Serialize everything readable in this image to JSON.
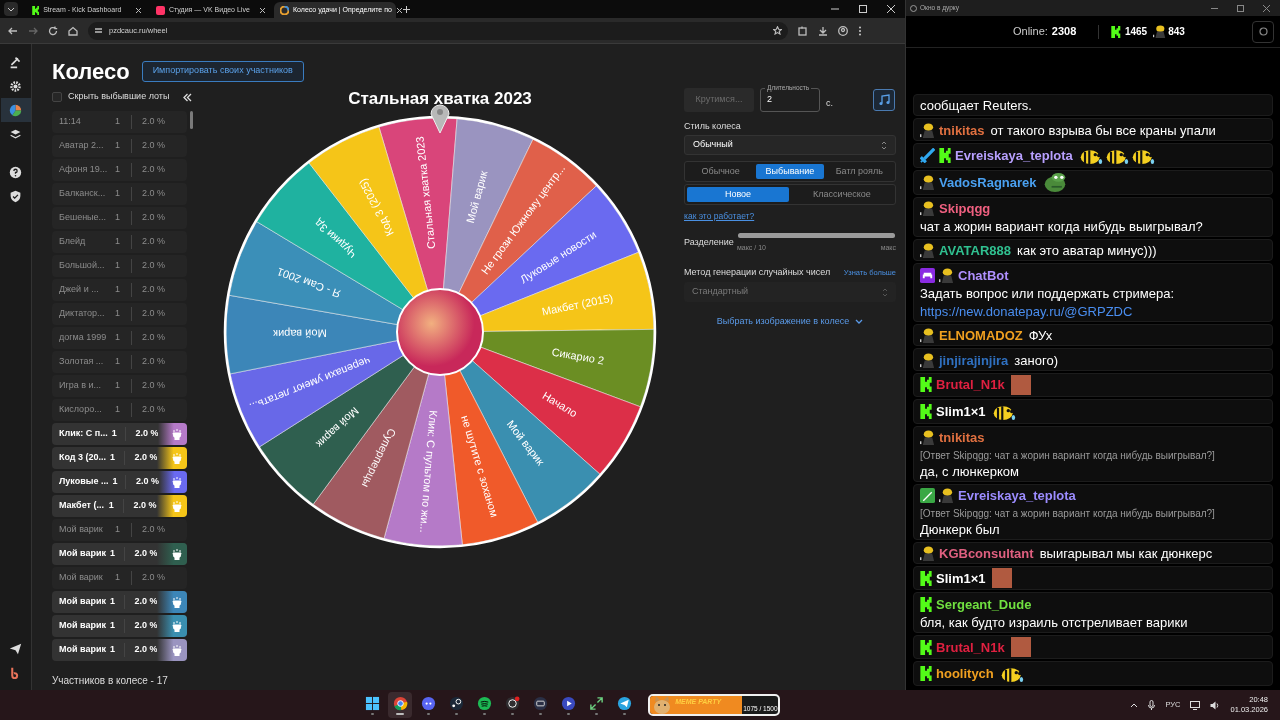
{
  "browser": {
    "tabs": [
      {
        "label": "Stream - Kick Dashboard",
        "kind": "kick",
        "selected": false
      },
      {
        "label": "Студия — VK Видео Live",
        "kind": "vk",
        "selected": false
      },
      {
        "label": "Колесо удачи | Определите по",
        "kind": "wheel",
        "selected": true
      }
    ],
    "url": "pzdcauc.ru/wheel"
  },
  "sidebar": {
    "items": [
      {
        "kind": "gavel",
        "selected": false
      },
      {
        "kind": "gear",
        "selected": false
      },
      {
        "kind": "pie",
        "selected": true
      },
      {
        "kind": "layers",
        "selected": false
      },
      {
        "kind": "help",
        "selected": false
      },
      {
        "kind": "shield",
        "selected": false
      },
      {
        "kind": "plane",
        "selected": false
      },
      {
        "kind": "logo",
        "selected": false
      }
    ]
  },
  "page": {
    "title": "Колесо",
    "import_button": "Импортировать своих участников",
    "hide_eliminated": {
      "label": "Скрыть выбывшие лоты",
      "checked": false
    },
    "participants": [
      {
        "name": "11:14",
        "count": "1",
        "percent": "2.0 %",
        "eliminated": true
      },
      {
        "name": "Аватар 2...",
        "count": "1",
        "percent": "2.0 %",
        "eliminated": true
      },
      {
        "name": "Афоня 19...",
        "count": "1",
        "percent": "2.0 %",
        "eliminated": true
      },
      {
        "name": "Балканск...",
        "count": "1",
        "percent": "2.0 %",
        "eliminated": true
      },
      {
        "name": "Бешеные...",
        "count": "1",
        "percent": "2.0 %",
        "eliminated": true
      },
      {
        "name": "Блейд",
        "count": "1",
        "percent": "2.0 %",
        "eliminated": true
      },
      {
        "name": "Большой...",
        "count": "1",
        "percent": "2.0 %",
        "eliminated": true
      },
      {
        "name": "Джей и ...",
        "count": "1",
        "percent": "2.0 %",
        "eliminated": true
      },
      {
        "name": "Диктатор...",
        "count": "1",
        "percent": "2.0 %",
        "eliminated": true
      },
      {
        "name": "догма 1999",
        "count": "1",
        "percent": "2.0 %",
        "eliminated": true
      },
      {
        "name": "Золотая ...",
        "count": "1",
        "percent": "2.0 %",
        "eliminated": true
      },
      {
        "name": "Игра в и...",
        "count": "1",
        "percent": "2.0 %",
        "eliminated": true
      },
      {
        "name": "Кислоро...",
        "count": "1",
        "percent": "2.0 %",
        "eliminated": true
      },
      {
        "name": "Клик: С п...",
        "count": "1",
        "percent": "2.0 %",
        "eliminated": false,
        "color": "#b57ac8"
      },
      {
        "name": "Код 3 (20...",
        "count": "1",
        "percent": "2.0 %",
        "eliminated": false,
        "color": "#f5c518"
      },
      {
        "name": "Луковые ...",
        "count": "1",
        "percent": "2.0 %",
        "eliminated": false,
        "color": "#6a6af0"
      },
      {
        "name": "Макбет (...",
        "count": "1",
        "percent": "2.0 %",
        "eliminated": false,
        "color": "#f5c518"
      },
      {
        "name": "Мой варик",
        "count": "1",
        "percent": "2.0 %",
        "eliminated": true
      },
      {
        "name": "Мой варик",
        "count": "1",
        "percent": "2.0 %",
        "eliminated": false,
        "color": "#2f5f4f"
      },
      {
        "name": "Мой варик",
        "count": "1",
        "percent": "2.0 %",
        "eliminated": true
      },
      {
        "name": "Мой варик",
        "count": "1",
        "percent": "2.0 %",
        "eliminated": false,
        "color": "#3c86b8"
      },
      {
        "name": "Мой варик",
        "count": "1",
        "percent": "2.0 %",
        "eliminated": false,
        "color": "#3a8fb0"
      },
      {
        "name": "Мой варик",
        "count": "1",
        "percent": "2.0 %",
        "eliminated": false,
        "color": "#9a94c0"
      }
    ],
    "footer": "Участников в колесе - 17"
  },
  "wheel": {
    "title": "Стальная хватка 2023",
    "slices": [
      {
        "label": "Стальная хватка 2023",
        "color": "#d9457a"
      },
      {
        "label": "Мой варик",
        "color": "#9a94c0"
      },
      {
        "label": "Не грози Южному центр...",
        "color": "#e0604a"
      },
      {
        "label": "Луковые новости",
        "color": "#6a6af0"
      },
      {
        "label": "Макбет (2015)",
        "color": "#f5c518"
      },
      {
        "label": "Сикарио 2",
        "color": "#6b8e23"
      },
      {
        "label": "Начало",
        "color": "#dc2f48"
      },
      {
        "label": "Мой варик",
        "color": "#3a8fb0"
      },
      {
        "label": "не шутите с зоханом",
        "color": "#f05a2a"
      },
      {
        "label": "Клик: С пультом по жи...",
        "color": "#b57ac8"
      },
      {
        "label": "Суперперцы",
        "color": "#a05a60"
      },
      {
        "label": "Мой варик",
        "color": "#2f5f4f"
      },
      {
        "label": "черепахи умеют летать...",
        "color": "#6868e8"
      },
      {
        "label": "Мой варик",
        "color": "#3c86b8"
      },
      {
        "label": "Я - Сам 2001",
        "color": "#3b8fb8"
      },
      {
        "label": "Чудики 3д",
        "color": "#1fb2a0"
      },
      {
        "label": "Код 3 (2025)",
        "color": "#f5c518"
      }
    ]
  },
  "settings": {
    "spin_button": {
      "label": "Крутимся...",
      "disabled": true
    },
    "duration": {
      "label": "Длительность",
      "value": "2",
      "unit": "с."
    },
    "style": {
      "label": "Стиль колеса",
      "value": "Обычный"
    },
    "modes": [
      {
        "label": "Обычное",
        "selected": false
      },
      {
        "label": "Выбывание",
        "selected": true
      },
      {
        "label": "Батл рояль",
        "selected": false
      }
    ],
    "variants": [
      {
        "label": "Новое",
        "selected": true
      },
      {
        "label": "Классическое",
        "selected": false
      }
    ],
    "help_link": "как это работает?",
    "split": {
      "label": "Разделение",
      "level": 1,
      "min_label": "макс / 10",
      "max_label": "макс"
    },
    "rng": {
      "label": "Метод генерации случайных чисел",
      "link": "Узнать больше",
      "value": "Стандартный",
      "disabled": true
    },
    "image_toggle": "Выбрать изображение в колесе"
  },
  "chat": {
    "window_title": "Окно в дурку",
    "online_label": "Online:",
    "online": "2308",
    "kick_count": "1465",
    "other_count": "843",
    "messages": [
      {
        "text": "сообщает Reuters."
      },
      {
        "badges": [
          {
            "kind": "figure"
          }
        ],
        "user": "tnikitas",
        "color": "#e07040",
        "text": "от такого взрыва бы все краны упали"
      },
      {
        "badges": [
          {
            "kind": "sword"
          },
          {
            "kind": "kick"
          }
        ],
        "user": "Evreiskaya_teplota",
        "color": "#b8a0ff",
        "emotes": [
          {
            "kind": "bee"
          },
          {
            "kind": "bee"
          },
          {
            "kind": "bee"
          }
        ]
      },
      {
        "badges": [
          {
            "kind": "figure"
          }
        ],
        "user": "VadosRagnarek",
        "color": "#4aa0f0",
        "emotes": [
          {
            "kind": "frog"
          }
        ]
      },
      {
        "badges": [
          {
            "kind": "figure"
          }
        ],
        "user": "Skipqgg",
        "color": "#f06080",
        "text": "чат а жорин вариант когда нибудь выигрывал?"
      },
      {
        "badges": [
          {
            "kind": "figure"
          }
        ],
        "user": "AVATAR888",
        "color": "#30c090",
        "text": "как это аватар минус)))"
      },
      {
        "badges": [
          {
            "kind": "bot"
          },
          {
            "kind": "figure"
          }
        ],
        "user": "ChatBot",
        "color": "#b090ff",
        "text": "Задать вопрос или поддержать стримера:",
        "link": "https://new.donatepay.ru/@GRPZDC"
      },
      {
        "badges": [
          {
            "kind": "figure"
          }
        ],
        "user": "ELNOMADOZ",
        "color": "#f0a020",
        "text": "ФУх"
      },
      {
        "badges": [
          {
            "kind": "figure"
          }
        ],
        "user": "jinjirajinjira",
        "color": "#2f70c0",
        "text": "заного)"
      },
      {
        "badges": [
          {
            "kind": "kick"
          }
        ],
        "user": "Brutal_N1k",
        "color": "#e02040",
        "emotes": [
          {
            "kind": "photo"
          }
        ]
      },
      {
        "badges": [
          {
            "kind": "kick"
          }
        ],
        "user": "Slim1×1",
        "color": "#ffffff",
        "emotes": [
          {
            "kind": "bee"
          }
        ]
      },
      {
        "badges": [
          {
            "kind": "figure"
          }
        ],
        "user": "tnikitas",
        "color": "#e07040",
        "reply": "[Ответ Skipqgg: чат а жорин вариант когда нибудь выигрывал?]",
        "text": "да, с люнкерком"
      },
      {
        "badges": [
          {
            "kind": "pen"
          },
          {
            "kind": "figure"
          }
        ],
        "user": "Evreiskaya_teplota",
        "color": "#9c8cff",
        "reply": "[Ответ Skipqgg: чат а жорин вариант когда нибудь выигрывал?]",
        "text": "Дюнкерк был"
      },
      {
        "badges": [
          {
            "kind": "figure"
          }
        ],
        "user": "KGBconsultant",
        "color": "#e06080",
        "text": "выигарывал мы как дюнкерс"
      },
      {
        "badges": [
          {
            "kind": "kick"
          }
        ],
        "user": "Slim1×1",
        "color": "#ffffff",
        "emotes": [
          {
            "kind": "photo"
          }
        ]
      },
      {
        "badges": [
          {
            "kind": "kick"
          }
        ],
        "user": "Sergeant_Dude",
        "color": "#70e040",
        "text": "бля, как будто израиль отстреливает варики"
      },
      {
        "badges": [
          {
            "kind": "kick"
          }
        ],
        "user": "Brutal_N1k",
        "color": "#e02040",
        "emotes": [
          {
            "kind": "photo"
          }
        ]
      },
      {
        "badges": [
          {
            "kind": "kick"
          }
        ],
        "user": "hoolitych",
        "color": "#f0a020",
        "emotes": [
          {
            "kind": "bee"
          }
        ]
      }
    ]
  },
  "taskbar": {
    "apps": [
      {
        "kind": "start",
        "selected": false
      },
      {
        "kind": "browser",
        "selected": true
      },
      {
        "kind": "discord",
        "selected": false
      },
      {
        "kind": "steam",
        "selected": false
      },
      {
        "kind": "music",
        "selected": false
      },
      {
        "kind": "record",
        "selected": false
      },
      {
        "kind": "monitor",
        "selected": false
      },
      {
        "kind": "play",
        "selected": false
      },
      {
        "kind": "arrows",
        "selected": false
      },
      {
        "kind": "plane",
        "selected": false
      }
    ],
    "widget": {
      "title": "MEME PARTY",
      "progress": "1075 / 1500",
      "level": 0.72
    },
    "language": "РУС",
    "time": "20:48",
    "date": "01.03.2026"
  }
}
